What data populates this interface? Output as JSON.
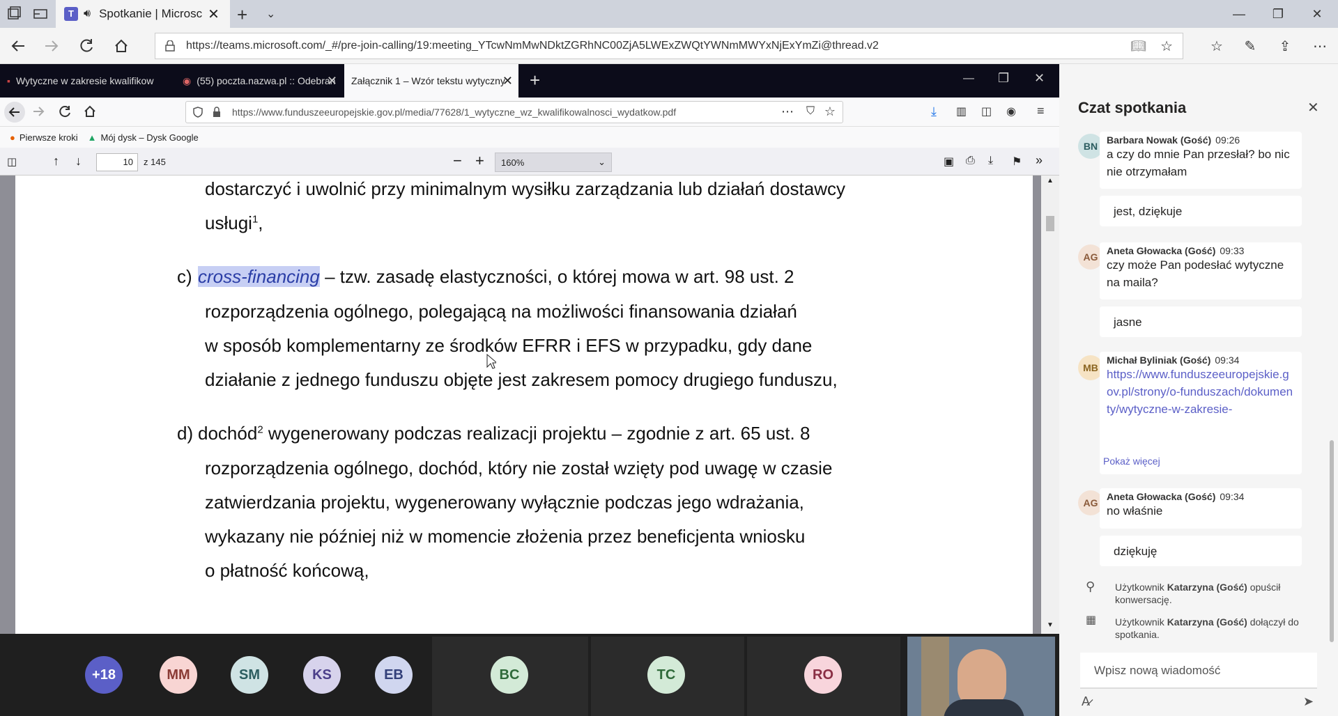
{
  "outer_browser": {
    "active_tab_title": "Spotkanie | Microsc",
    "url": "https://teams.microsoft.com/_#/pre-join-calling/19:meeting_YTcwNmMwNDktZGRhNC00ZjA5LWExZWQtYWNmMWYxNjExYmZi@thread.v2"
  },
  "firefox": {
    "tabs": [
      {
        "label": "Wytyczne w zakresie kwalifikow"
      },
      {
        "label": "(55) poczta.nazwa.pl :: Odebran"
      },
      {
        "label": "Załącznik 1 – Wzór tekstu wytyczny"
      }
    ],
    "url": "https://www.funduszeeuropejskie.gov.pl/media/77628/1_wytyczne_wz_kwalifikowalnosci_wydatkow.pdf",
    "bookmarks": [
      "Pierwsze kroki",
      "Mój dysk – Dysk Google"
    ],
    "pdf": {
      "page_number": "10",
      "page_total": "z 145",
      "zoom": "160%"
    }
  },
  "document": {
    "line1": "dostarczyć i uwolnić przy minimalnym wysiłku zarządzania lub działań dostawcy",
    "line2_text": "usługi",
    "line2_sup": "1",
    "line2_tail": ",",
    "c_label": "c)",
    "c_highlight": "cross-financing",
    "c_line1_rest": " – tzw. zasadę elastyczności, o której mowa w art. 98 ust. 2",
    "c_line2": "rozporządzenia ogólnego, polegającą na możliwości finansowania działań",
    "c_line3": "w sposób komplementarny ze środków EFRR i EFS w przypadku, gdy dane",
    "c_line4": "działanie z jednego funduszu objęte jest zakresem pomocy drugiego funduszu,",
    "d_label": "d)",
    "d_word": "dochód",
    "d_sup": "2",
    "d_line1_rest": " wygenerowany podczas realizacji projektu – zgodnie z art. 65 ust. 8",
    "d_line2": "rozporządzenia ogólnego, dochód, który nie został wzięty pod uwagę w czasie",
    "d_line3": "zatwierdzania projektu, wygenerowany wyłącznie podczas jego wdrażania,",
    "d_line4": "wykazany nie później niż w momencie złożenia przez beneficjenta wniosku",
    "d_line5": "o płatność końcową,"
  },
  "meeting": {
    "participants": [
      {
        "initials": "+18",
        "color": "#5b5fc7",
        "text_color": "#ffffff"
      },
      {
        "initials": "MM",
        "color": "#f8d5d3",
        "text_color": "#8a3b35"
      },
      {
        "initials": "SM",
        "color": "#cfe3e4",
        "text_color": "#2c5d60"
      },
      {
        "initials": "KS",
        "color": "#d7d3ec",
        "text_color": "#4b3f8a"
      },
      {
        "initials": "EB",
        "color": "#d0d6ef",
        "text_color": "#33407a"
      },
      {
        "initials": "BC",
        "color": "#d3ead7",
        "text_color": "#2f6a3a"
      },
      {
        "initials": "TC",
        "color": "#d3ead7",
        "text_color": "#2f6a3a"
      },
      {
        "initials": "RO",
        "color": "#f8d5dc",
        "text_color": "#8a2f45"
      }
    ]
  },
  "chat": {
    "title": "Czat spotkania",
    "messages": [
      {
        "initials": "BN",
        "author": "Barbara Nowak (Gość)",
        "time": "09:26",
        "text": "a czy do mnie Pan przesłał? bo nic nie otrzymałam"
      },
      {
        "text": "jest, dziękuje"
      },
      {
        "initials": "AG",
        "author": "Aneta Głowacka (Gość)",
        "time": "09:33",
        "text": "czy może Pan podesłać wytyczne na maila?"
      },
      {
        "text": "jasne"
      },
      {
        "initials": "MB",
        "author": "Michał Byliniak (Gość)",
        "time": "09:34",
        "link": "https://www.funduszeeuropejskie.gov.pl/strony/o-funduszach/dokumenty/wytyczne-w-zakresie-",
        "more": "Pokaż więcej"
      },
      {
        "initials": "AG",
        "author": "Aneta Głowacka (Gość)",
        "time": "09:34",
        "text": "no właśnie"
      },
      {
        "text": "dziękuję"
      }
    ],
    "system": [
      {
        "pre": "Użytkownik ",
        "bold": "Katarzyna (Gość)",
        "post": " opuścił konwersację."
      },
      {
        "pre": "Użytkownik ",
        "bold": "Katarzyna (Gość)",
        "post": " dołączył do spotkania."
      }
    ],
    "input_placeholder": "Wpisz nową wiadomość"
  }
}
